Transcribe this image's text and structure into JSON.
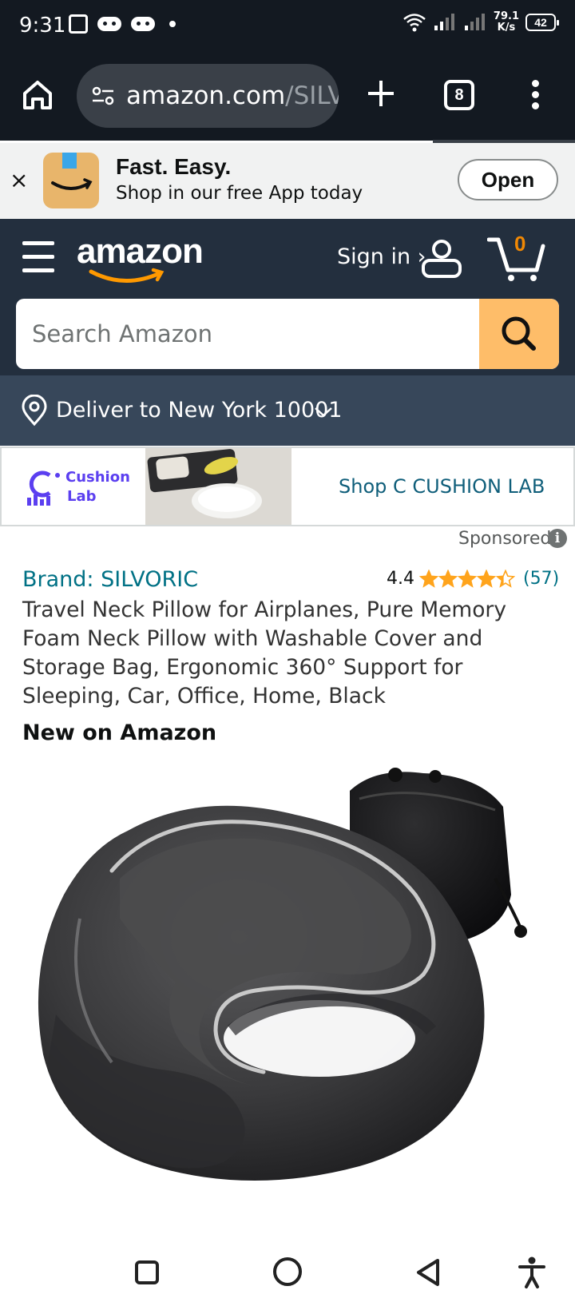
{
  "status_bar": {
    "time": "9:31",
    "net_speed_value": "79.1",
    "net_speed_unit": "K/s",
    "battery": "42"
  },
  "browser": {
    "url_host": "amazon.com",
    "url_path": "/SILV",
    "tab_count": "8"
  },
  "app_banner": {
    "close": "×",
    "title": "Fast. Easy.",
    "subtitle": "Shop in our free App today",
    "open_label": "Open"
  },
  "header": {
    "logo_text": "amazon",
    "sign_in": "Sign in ›",
    "cart_count": "0",
    "search_placeholder": "Search Amazon",
    "deliver_to": "Deliver to New York 10001"
  },
  "sponsor": {
    "logo_line1": "Cushion",
    "logo_line2": "Lab",
    "shop_label": "Shop C CUSHION LAB",
    "sponsored_label": "Sponsored",
    "info": "i"
  },
  "product": {
    "brand": "Brand: SILVORIC",
    "rating_value": "4.4",
    "rating_stars": 4.4,
    "rating_count": "(57)",
    "title": "Travel Neck Pillow for Airplanes, Pure Memory Foam Neck Pillow with Washable Cover and Storage Bag, Ergonomic 360° Support for Sleeping, Car, Office, Home, Black",
    "badge": "New on Amazon"
  },
  "colors": {
    "header_dark": "#131921",
    "header_nav": "#232f3e",
    "deliver_bar": "#37475a",
    "search_button": "#febd69",
    "link": "#007185",
    "star": "#ffa41c",
    "cart_count": "#f08804"
  },
  "icons": [
    "home-icon",
    "tune-icon",
    "plus-icon",
    "tabs-icon",
    "more-vert-icon",
    "close-icon",
    "hamburger-icon",
    "user-icon",
    "cart-icon",
    "search-icon",
    "location-pin-icon",
    "chevron-down-icon",
    "info-icon",
    "star-icon",
    "recent-apps-icon",
    "nav-home-icon",
    "nav-back-icon",
    "accessibility-icon"
  ]
}
